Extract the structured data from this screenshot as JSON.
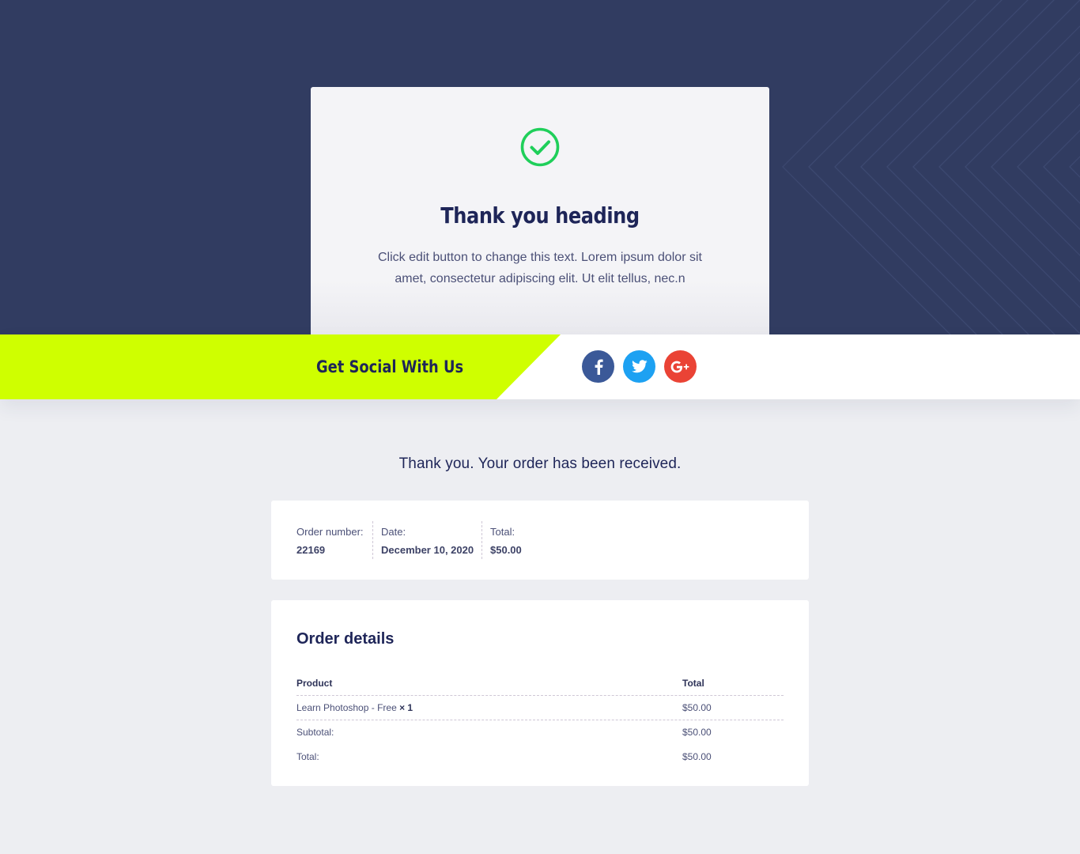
{
  "hero": {
    "heading": "Thank you heading",
    "text": "Click edit button to change this text. Lorem ipsum dolor sit amet, consectetur adipiscing elit. Ut elit tellus, nec.n",
    "icon": "check-circle-icon"
  },
  "social": {
    "title": "Get Social With Us",
    "buttons": [
      {
        "icon": "facebook-icon",
        "color": "#3b5998"
      },
      {
        "icon": "twitter-icon",
        "color": "#1da1f2"
      },
      {
        "icon": "google-plus-icon",
        "color": "#ea4335"
      }
    ]
  },
  "order": {
    "heading": "Thank you. Your order has been received.",
    "number_label": "Order number:",
    "number": "22169",
    "date_label": "Date:",
    "date": "December 10, 2020",
    "total_label": "Total:",
    "total": "$50.00"
  },
  "details": {
    "title": "Order details",
    "columns": [
      "Product",
      "Total"
    ],
    "item": {
      "name": "Learn Photoshop - Free",
      "qty": "× 1",
      "total": "$50.00"
    },
    "subtotal_label": "Subtotal:",
    "subtotal": "$50.00",
    "total_label": "Total:",
    "total": "$50.00"
  },
  "colors": {
    "navy": "#313c61",
    "lime": "#cfff00",
    "heading": "#1e2558",
    "check": "#1fcf5a"
  }
}
